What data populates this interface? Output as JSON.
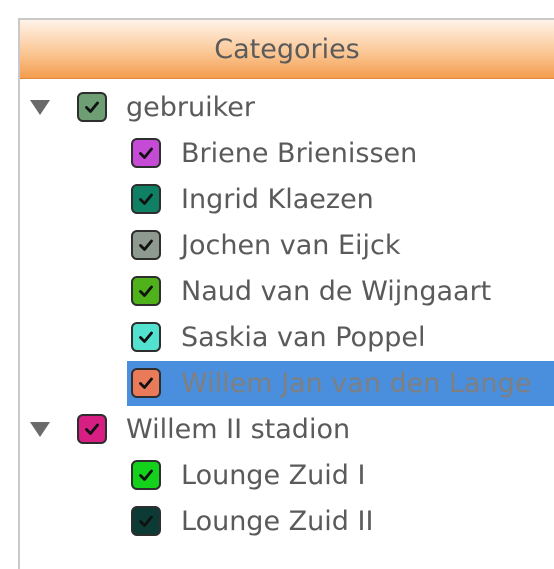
{
  "header": {
    "title": "Categories"
  },
  "groups": [
    {
      "label": "gebruiker",
      "color": "#6d9e74",
      "items": [
        {
          "label": "Briene Brienissen",
          "color": "#c54bd6"
        },
        {
          "label": "Ingrid Klaezen",
          "color": "#0f8063"
        },
        {
          "label": "Jochen van Eijck",
          "color": "#8e9a90"
        },
        {
          "label": "Naud van de Wijngaart",
          "color": "#4fb21a"
        },
        {
          "label": "Saskia van Poppel",
          "color": "#54e2d0"
        },
        {
          "label": "Willem Jan van den Lange",
          "color": "#ea7b5a",
          "selected": true
        }
      ]
    },
    {
      "label": "Willem II stadion",
      "color": "#d61e83",
      "items": [
        {
          "label": "Lounge Zuid I",
          "color": "#14d11c"
        },
        {
          "label": "Lounge Zuid II",
          "color": "#0c3b35"
        }
      ]
    }
  ],
  "icons": {
    "expand": "triangle-down-icon",
    "check": "checkmark-icon"
  },
  "accent": {
    "header_orange": "#f39d4e",
    "selection_blue": "#4a8fde"
  }
}
